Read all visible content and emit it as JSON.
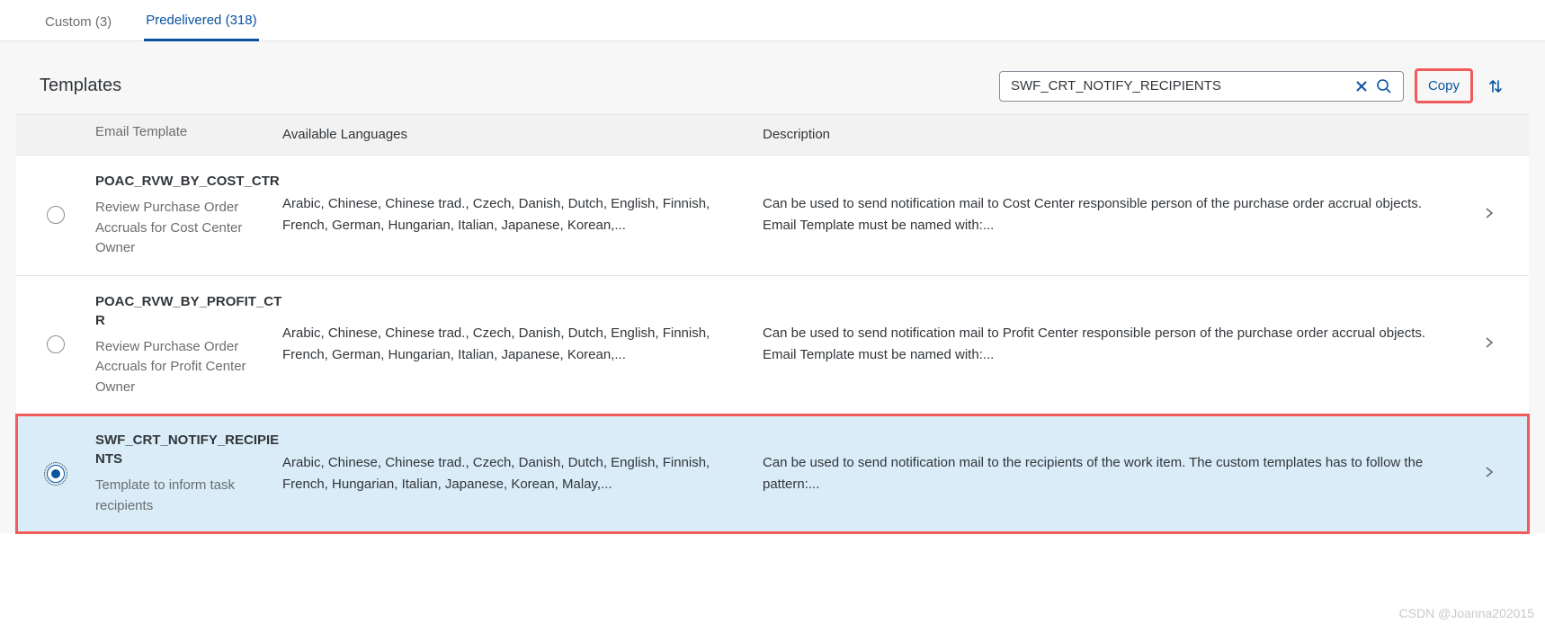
{
  "tabs": {
    "custom": "Custom (3)",
    "predelivered": "Predelivered (318)"
  },
  "toolbar": {
    "title": "Templates",
    "search_value": "SWF_CRT_NOTIFY_RECIPIENTS",
    "copy_label": "Copy"
  },
  "columns": {
    "name": "Email Template",
    "langs": "Available Languages",
    "desc": "Description"
  },
  "rows": [
    {
      "id": "POAC_RVW_BY_COST_CTR",
      "subtitle": "Review Purchase Order Accruals for Cost Center Owner",
      "langs": "Arabic, Chinese, Chinese trad., Czech, Danish, Dutch, English, Finnish, French, German, Hungarian, Italian, Japanese, Korean,...",
      "desc": "Can be used to send notification mail to Cost Center responsible person of the purchase order accrual objects. Email Template must be named with:...",
      "selected": false
    },
    {
      "id": "POAC_RVW_BY_PROFIT_CTR",
      "subtitle": "Review Purchase Order Accruals for Profit Center Owner",
      "langs": "Arabic, Chinese, Chinese trad., Czech, Danish, Dutch, English, Finnish, French, German, Hungarian, Italian, Japanese, Korean,...",
      "desc": "Can be used to send notification mail to Profit Center responsible person of the purchase order accrual objects. Email Template must be named with:...",
      "selected": false
    },
    {
      "id": "SWF_CRT_NOTIFY_RECIPIENTS",
      "subtitle": "Template to inform task recipients",
      "langs": "Arabic, Chinese, Chinese trad., Czech, Danish, Dutch, English, Finnish, French, Hungarian, Italian, Japanese, Korean, Malay,...",
      "desc": "Can be used to send notification mail to the recipients of the work item. The custom templates has to follow the pattern:...",
      "selected": true
    }
  ],
  "watermark": "CSDN @Joanna202015"
}
